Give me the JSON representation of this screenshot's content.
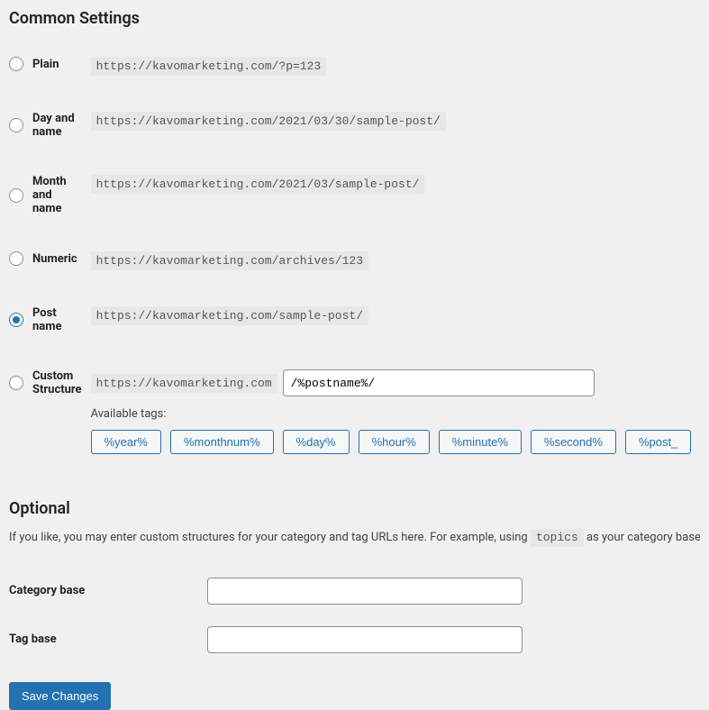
{
  "headings": {
    "common_settings": "Common Settings",
    "optional": "Optional"
  },
  "permalink_options": [
    {
      "label": "Plain",
      "sample": "https://kavomarketing.com/?p=123",
      "selected": false
    },
    {
      "label": "Day and name",
      "sample": "https://kavomarketing.com/2021/03/30/sample-post/",
      "selected": false
    },
    {
      "label": "Month and name",
      "sample": "https://kavomarketing.com/2021/03/sample-post/",
      "selected": false
    },
    {
      "label": "Numeric",
      "sample": "https://kavomarketing.com/archives/123",
      "selected": false
    },
    {
      "label": "Post name",
      "sample": "https://kavomarketing.com/sample-post/",
      "selected": true
    }
  ],
  "custom_structure": {
    "label": "Custom Structure",
    "base_url": "https://kavomarketing.com",
    "value": "/%postname%/",
    "selected": false,
    "available_tags_label": "Available tags:",
    "tags": [
      "%year%",
      "%monthnum%",
      "%day%",
      "%hour%",
      "%minute%",
      "%second%",
      "%post_"
    ]
  },
  "optional_section": {
    "description_pre": "If you like, you may enter custom structures for your category and tag URLs here. For example, using ",
    "description_code": "topics",
    "description_post": " as your category base wo",
    "category_base_label": "Category base",
    "category_base_value": "",
    "tag_base_label": "Tag base",
    "tag_base_value": ""
  },
  "save_button": "Save Changes"
}
